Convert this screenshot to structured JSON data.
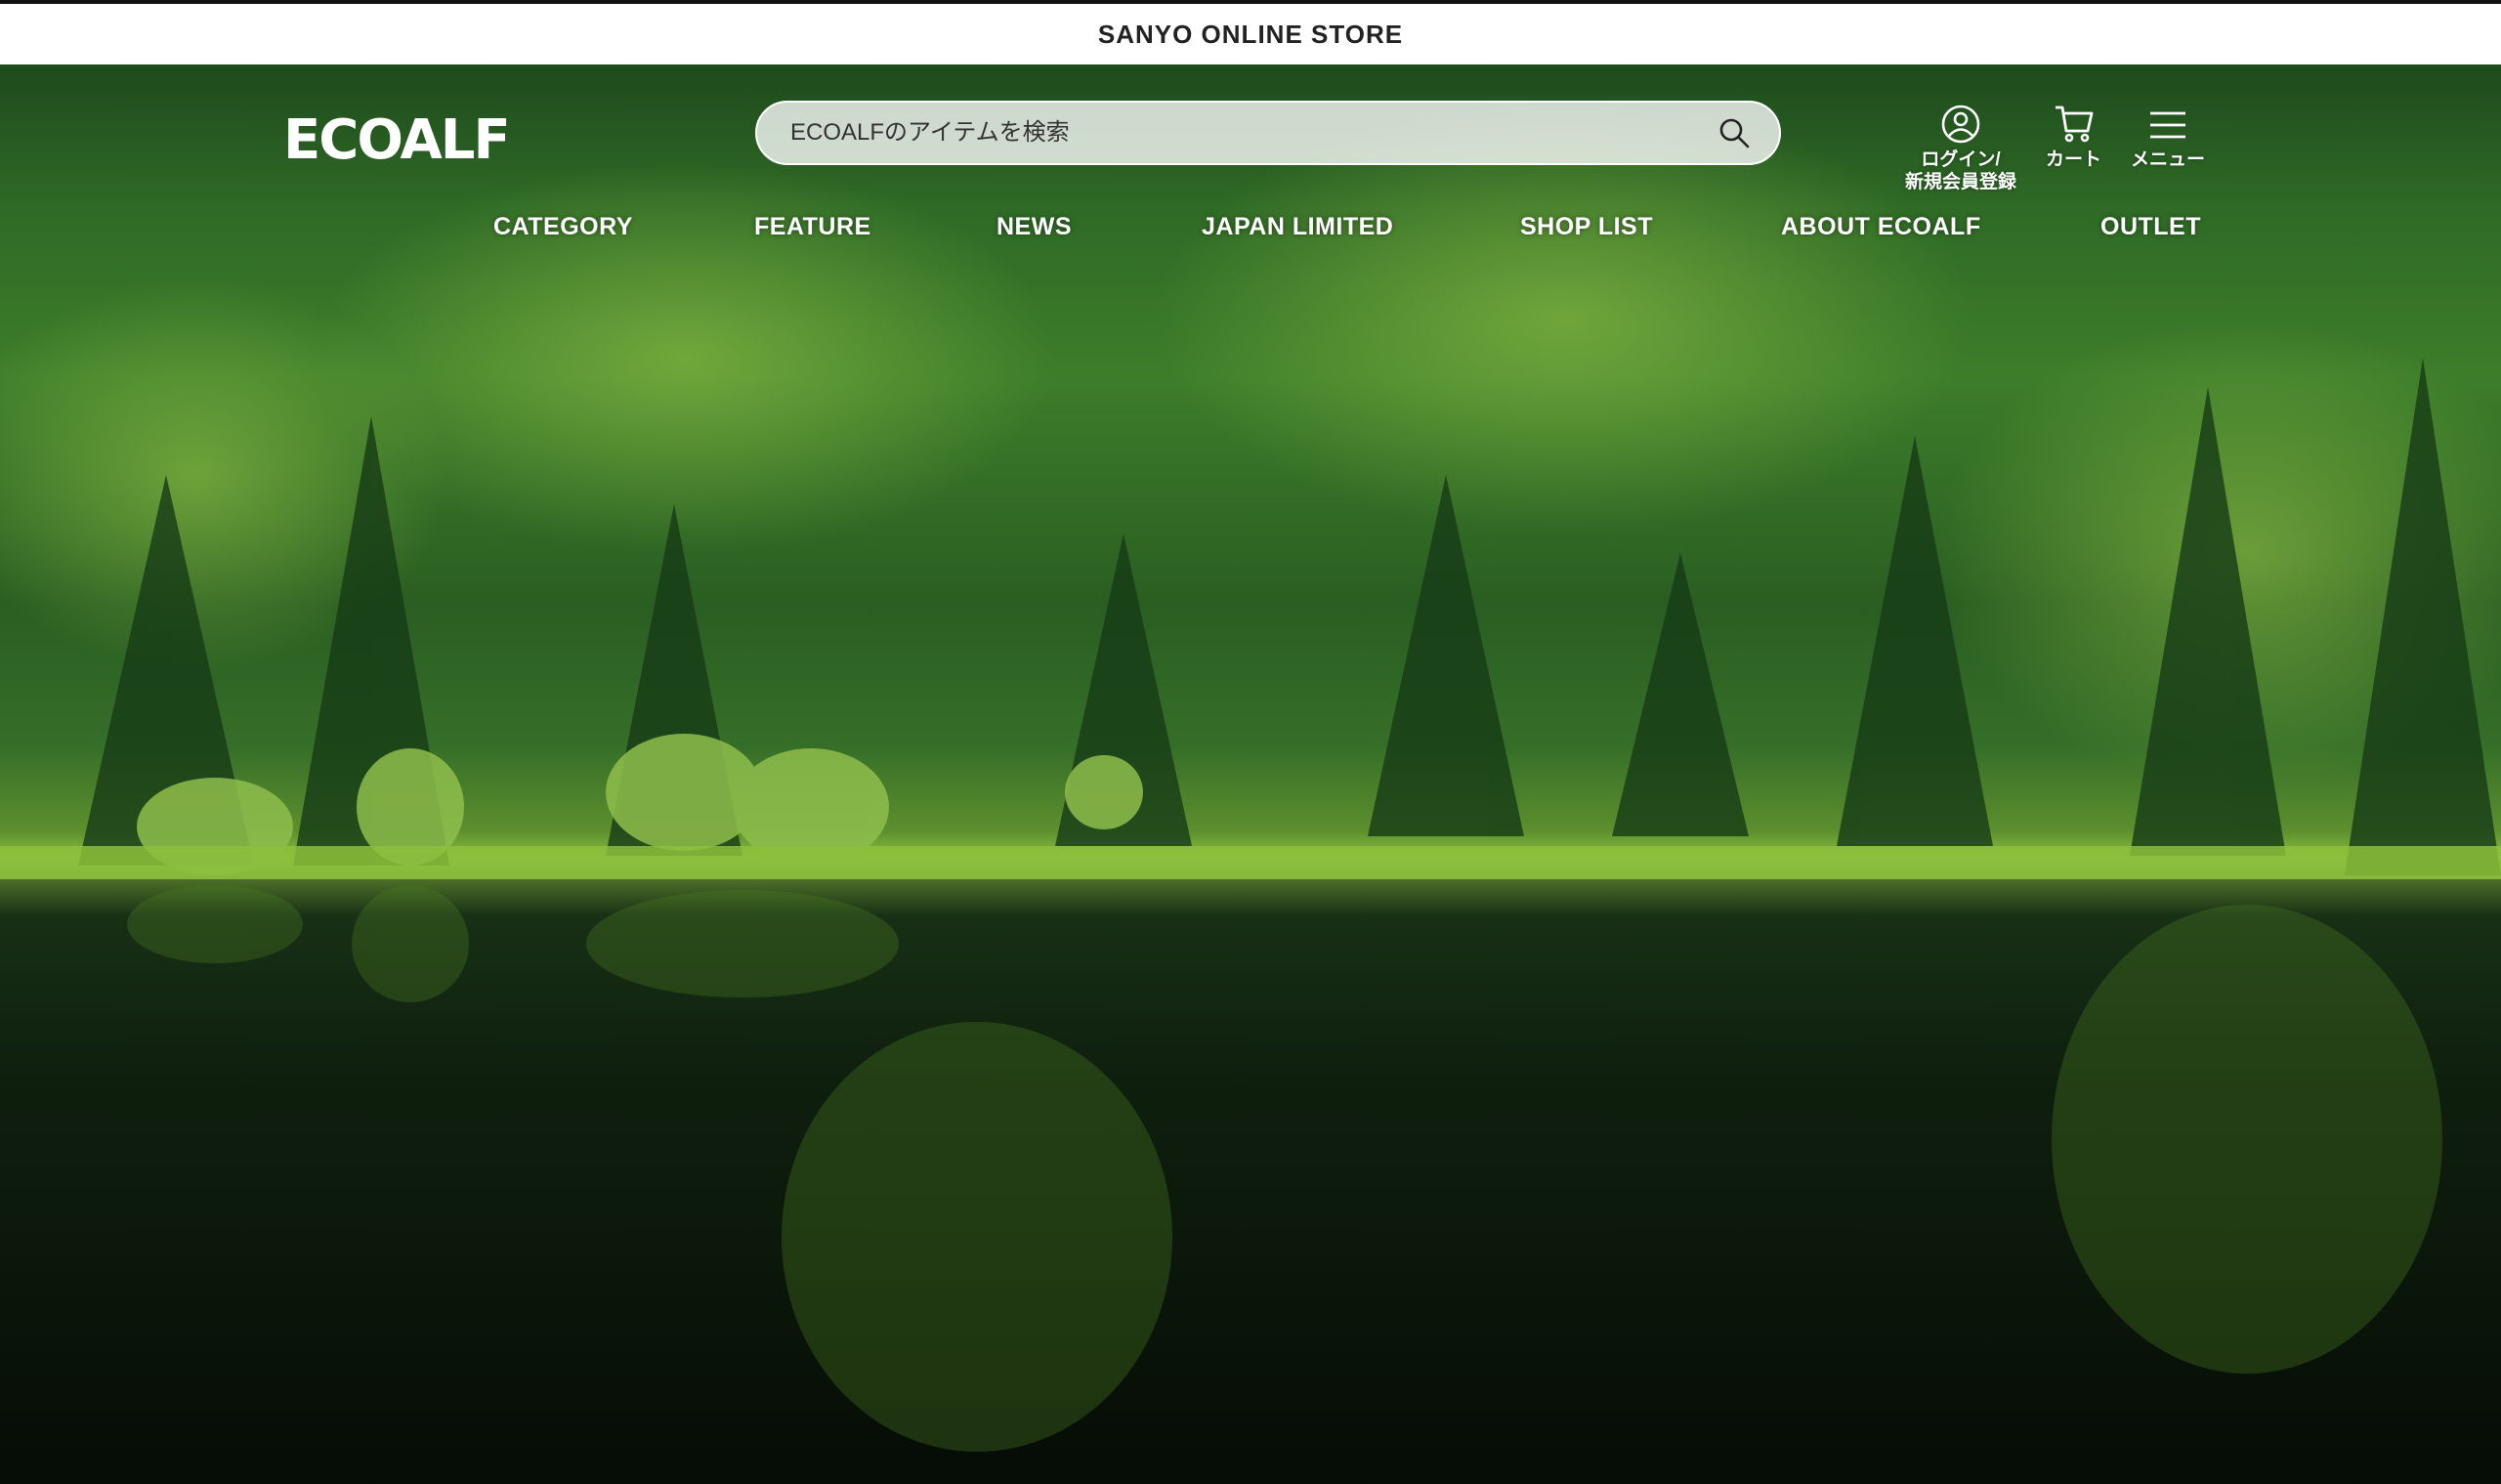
{
  "topbar": {
    "title": "SANYO ONLINE STORE"
  },
  "header": {
    "logo_text": "ECOALF",
    "search": {
      "placeholder": "ECOALFのアイテムを検索",
      "icon": "search-icon"
    },
    "icons": [
      {
        "name": "user-icon",
        "label_line1": "ログイン/",
        "label_line2": "新規会員登録"
      },
      {
        "name": "cart-icon",
        "label_line1": "カート"
      },
      {
        "name": "hamburger-icon",
        "label_line1": "メニュー"
      }
    ]
  },
  "nav": {
    "items": [
      {
        "label": "CATEGORY"
      },
      {
        "label": "FEATURE"
      },
      {
        "label": "NEWS"
      },
      {
        "label": "JAPAN LIMITED"
      },
      {
        "label": "SHOP LIST"
      },
      {
        "label": "ABOUT ECOALF"
      },
      {
        "label": "OUTLET"
      }
    ]
  },
  "colors": {
    "topbar_bg": "#ffffff",
    "text_on_hero": "#ffffff",
    "forest_dark": "#1e4a1c",
    "lake_dark": "#0a150a"
  }
}
